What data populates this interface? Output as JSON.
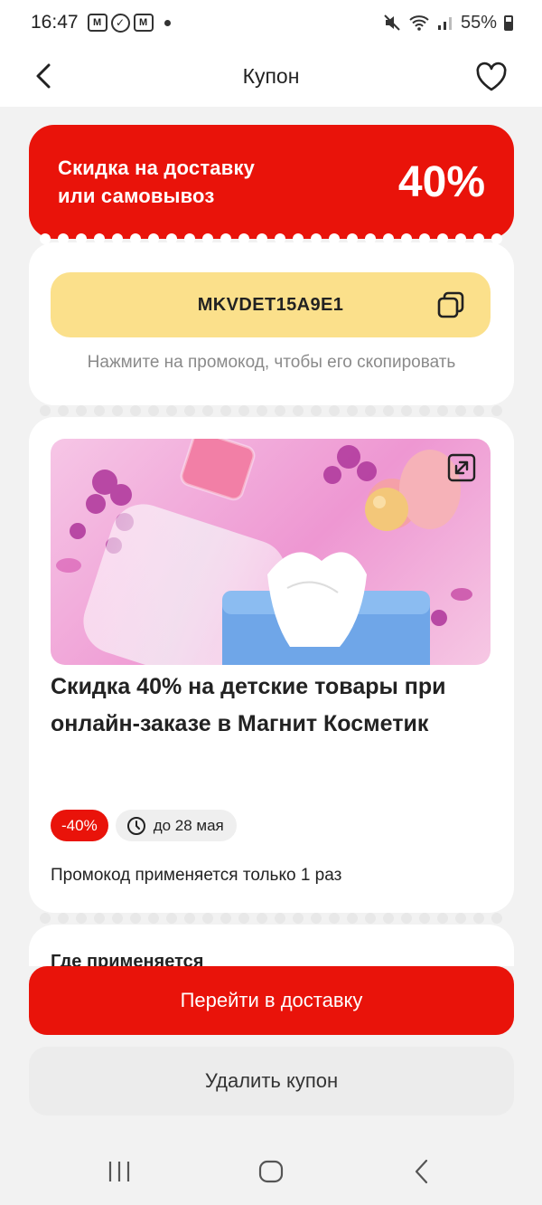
{
  "status_bar": {
    "time": "16:47",
    "app_icon_1": "М",
    "app_icon_2": "✓",
    "app_icon_3": "М",
    "signal": "⁺ᵢₗ",
    "battery_percent": "55%"
  },
  "header": {
    "title": "Купон",
    "back_icon": "chevron-left-icon",
    "favorite_icon": "heart-icon"
  },
  "coupon": {
    "discount_label_line1": "Скидка на доставку",
    "discount_label_line2": "или самовывоз",
    "discount_value": "40%",
    "promo_code": "MKVDET15A9E1",
    "copy_hint": "Нажмите на промокод, чтобы его скопировать"
  },
  "offer": {
    "title": "Скидка 40% на детские товары при онлайн-заказе в Магнит Косметик",
    "badge_discount": "-40%",
    "badge_date": "до 28 мая",
    "usage_note": "Промокод применяется только 1 раз",
    "where_heading": "Где применяется"
  },
  "actions": {
    "primary_label": "Перейти в доставку",
    "secondary_label": "Удалить купон"
  },
  "colors": {
    "accent_red": "#e9130a",
    "promo_yellow": "#fbe08b",
    "background": "#f2f2f2"
  }
}
